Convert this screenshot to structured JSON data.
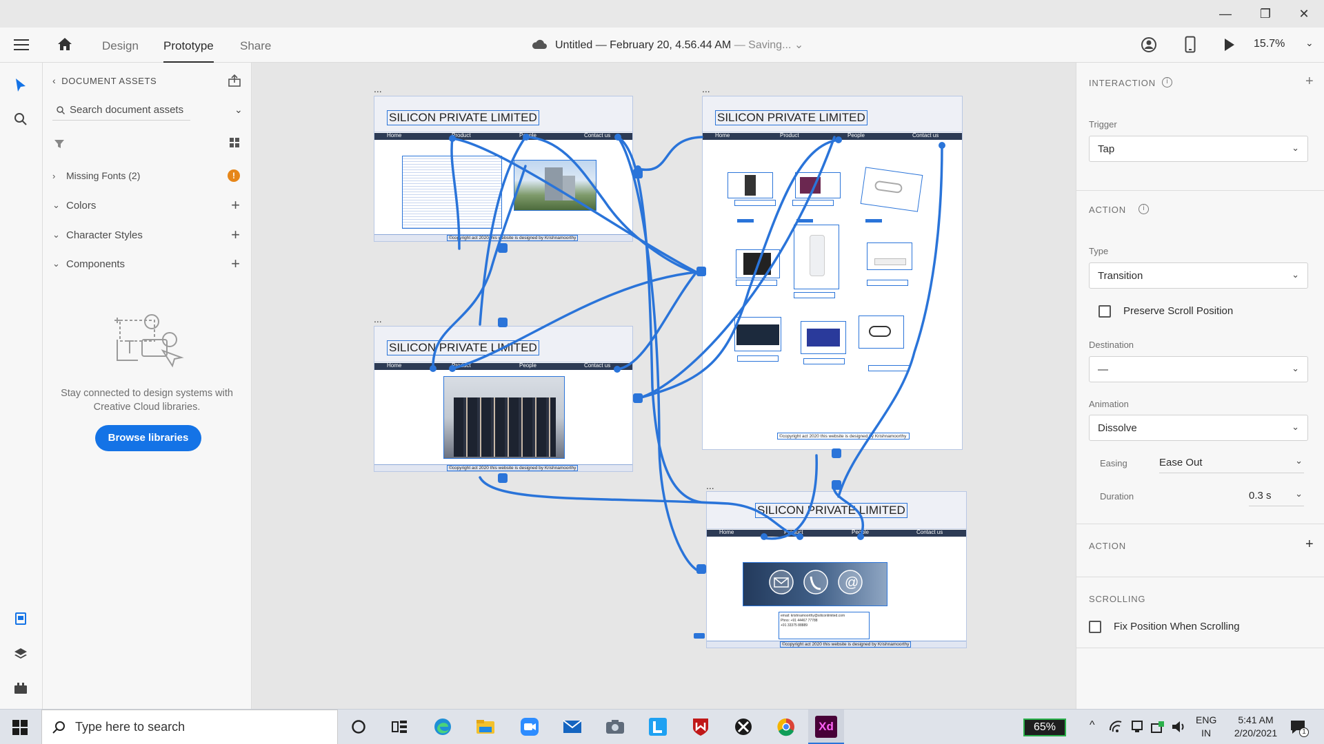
{
  "window": {
    "minimize_glyph": "—",
    "restore_glyph": "❐",
    "close_glyph": "✕"
  },
  "appbar": {
    "tabs": [
      "Design",
      "Prototype",
      "Share"
    ],
    "active_tab": "Prototype",
    "doc_title": "Untitled — February 20, 4.56.44 AM",
    "doc_separator": "—",
    "doc_status": "Saving...",
    "zoom": "15.7%"
  },
  "assets": {
    "title": "DOCUMENT ASSETS",
    "search_placeholder": "Search document assets",
    "missing_fonts": "Missing Fonts (2)",
    "sections": [
      "Colors",
      "Character Styles",
      "Components"
    ],
    "empty_message": "Stay connected to design systems with Creative Cloud libraries.",
    "browse_button": "Browse libraries"
  },
  "canvas": {
    "artboards": [
      {
        "id": "home",
        "title": "SILICON PRIVATE LIMITED",
        "nav": [
          "Home",
          "Product",
          "People",
          "Contact us"
        ],
        "footer": "©copyright act 2020 this website is designed by Krishnamoorthy",
        "ellipsis": "..."
      },
      {
        "id": "product",
        "title": "SILICON PRIVATE LIMITED",
        "nav": [
          "Home",
          "Product",
          "People",
          "Contact us"
        ],
        "footer": "©copyright act 2020 this website is designed by Krishnamoorthy",
        "ellipsis": "..."
      },
      {
        "id": "people",
        "title": "SILICON PRIVATE LIMITED",
        "nav": [
          "Home",
          "Product",
          "People",
          "Contact us"
        ],
        "footer": "©copyright act 2020 this website is designed by Krishnamoorthy",
        "ellipsis": "..."
      },
      {
        "id": "contact",
        "title": "SILICON PRIVATE LIMITED",
        "nav": [
          "Home",
          "Product",
          "People",
          "Contact us"
        ],
        "footer": "©copyright act 2020 this website is designed by Krishnamoorthy",
        "ellipsis": "...",
        "email": "email: krishnamoorthy@siliconlimited.com",
        "phone": "Phno: +91 44467 77788",
        "phone2": "+91 33375 88889"
      }
    ],
    "wire_color": "#2a74d9"
  },
  "inspector": {
    "interaction_title": "INTERACTION",
    "trigger_label": "Trigger",
    "trigger_value": "Tap",
    "action_title": "ACTION",
    "type_label": "Type",
    "type_value": "Transition",
    "preserve_scroll": "Preserve Scroll Position",
    "destination_label": "Destination",
    "destination_value": "—",
    "animation_label": "Animation",
    "animation_value": "Dissolve",
    "easing_label": "Easing",
    "easing_value": "Ease Out",
    "duration_label": "Duration",
    "duration_value": "0.3 s",
    "action2_title": "ACTION",
    "scrolling_title": "SCROLLING",
    "fix_position": "Fix Position When Scrolling"
  },
  "taskbar": {
    "search_placeholder": "Type here to search",
    "battery": "65%",
    "lang1": "ENG",
    "lang2": "IN",
    "time": "5:41 AM",
    "date": "2/20/2021",
    "notifications": "1"
  },
  "colors": {
    "accent": "#2a74d9",
    "browse_button_bg": "#1473e6",
    "warning": "#e68619",
    "xd_brand": "#470137",
    "xd_brand_text": "#ff61f6"
  }
}
